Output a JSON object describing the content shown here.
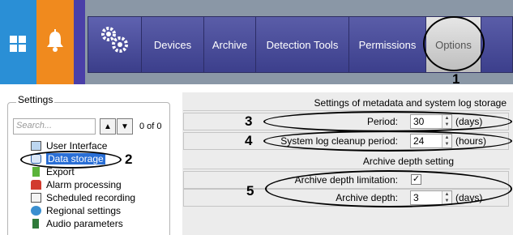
{
  "menu": {
    "items": [
      {
        "label": "Devices"
      },
      {
        "label": "Archive"
      },
      {
        "label": "Detection Tools"
      },
      {
        "label": "Permissions"
      },
      {
        "label": "Options"
      }
    ]
  },
  "settings_panel": {
    "title": "Settings",
    "search_placeholder": "Search...",
    "up_glyph": "▲",
    "down_glyph": "▼",
    "count_text": "0 of 0",
    "tree": [
      {
        "label": "User Interface",
        "icon": "monitor-icon"
      },
      {
        "label": "Data storage",
        "icon": "database-icon",
        "selected": true
      },
      {
        "label": "Export",
        "icon": "export-icon"
      },
      {
        "label": "Alarm processing",
        "icon": "alarm-icon"
      },
      {
        "label": "Scheduled recording",
        "icon": "schedule-icon"
      },
      {
        "label": "Regional settings",
        "icon": "globe-icon"
      },
      {
        "label": "Audio parameters",
        "icon": "speaker-icon"
      }
    ]
  },
  "metadata": {
    "heading": "Settings of metadata and system log storage",
    "period_label": "Period:",
    "period_value": "30",
    "period_unit": "(days)",
    "cleanup_label": "System log cleanup period:",
    "cleanup_value": "24",
    "cleanup_unit": "(hours)"
  },
  "archive_depth": {
    "heading": "Archive depth setting",
    "limit_label": "Archive depth limitation:",
    "limit_checked": true,
    "check_glyph": "✓",
    "depth_label": "Archive depth:",
    "depth_value": "3",
    "depth_unit": "(days)"
  },
  "callouts": {
    "c1": "1",
    "c2": "2",
    "c3": "3",
    "c4": "4",
    "c5": "5"
  },
  "colors": {
    "accent_blue": "#2a8fd6",
    "accent_orange": "#f08a1e",
    "menu_purple": "#4e4f8e",
    "selection": "#2a6fd6"
  }
}
